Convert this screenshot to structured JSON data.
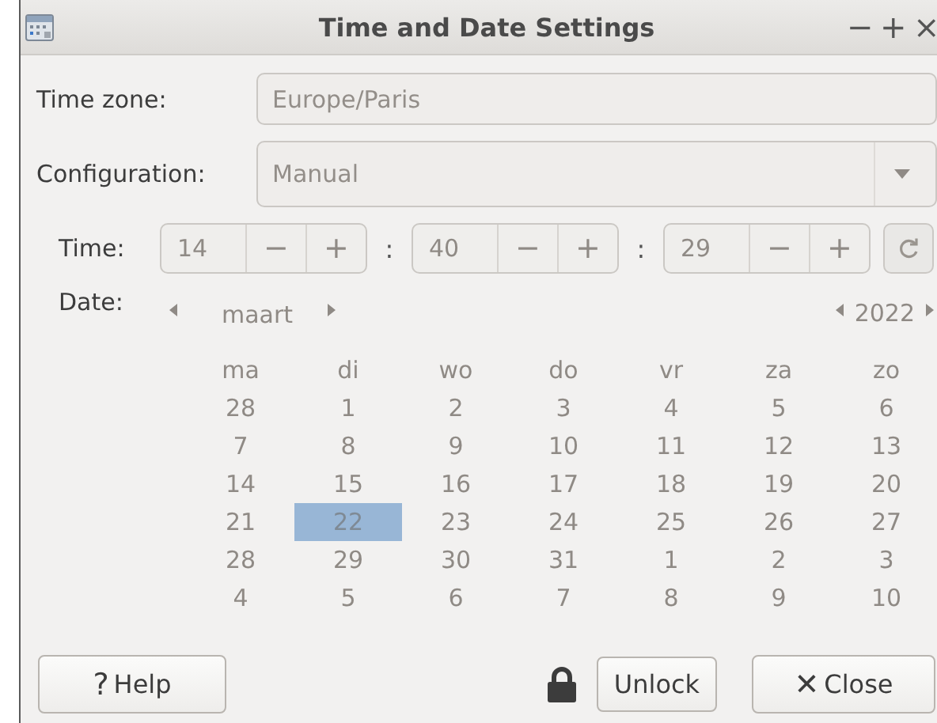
{
  "window": {
    "title": "Time and Date Settings",
    "controls": [
      "−",
      "+",
      "×"
    ]
  },
  "time_zone": {
    "label": "Time zone:",
    "value": "Europe/Paris"
  },
  "configuration": {
    "label": "Configuration:",
    "value": "Manual"
  },
  "time": {
    "label": "Time:",
    "fields": [
      {
        "value": "14",
        "decrement": "−",
        "increment": "+"
      },
      {
        "value": "40",
        "decrement": "−",
        "increment": "+"
      },
      {
        "value": "29",
        "decrement": "−",
        "increment": "+"
      }
    ],
    "separators": [
      ":",
      ":"
    ]
  },
  "date": {
    "label": "Date:",
    "month": "maart",
    "year": "2022",
    "weekdays": [
      "ma",
      "di",
      "wo",
      "do",
      "vr",
      "za",
      "zo"
    ],
    "weeks": [
      [
        {
          "day": "28",
          "selected": false
        },
        {
          "day": "1",
          "selected": false
        },
        {
          "day": "2",
          "selected": false
        },
        {
          "day": "3",
          "selected": false
        },
        {
          "day": "4",
          "selected": false
        },
        {
          "day": "5",
          "selected": false
        },
        {
          "day": "6",
          "selected": false
        }
      ],
      [
        {
          "day": "7",
          "selected": false
        },
        {
          "day": "8",
          "selected": false
        },
        {
          "day": "9",
          "selected": false
        },
        {
          "day": "10",
          "selected": false
        },
        {
          "day": "11",
          "selected": false
        },
        {
          "day": "12",
          "selected": false
        },
        {
          "day": "13",
          "selected": false
        }
      ],
      [
        {
          "day": "14",
          "selected": false
        },
        {
          "day": "15",
          "selected": false
        },
        {
          "day": "16",
          "selected": false
        },
        {
          "day": "17",
          "selected": false
        },
        {
          "day": "18",
          "selected": false
        },
        {
          "day": "19",
          "selected": false
        },
        {
          "day": "20",
          "selected": false
        }
      ],
      [
        {
          "day": "21",
          "selected": false
        },
        {
          "day": "22",
          "selected": true
        },
        {
          "day": "23",
          "selected": false
        },
        {
          "day": "24",
          "selected": false
        },
        {
          "day": "25",
          "selected": false
        },
        {
          "day": "26",
          "selected": false
        },
        {
          "day": "27",
          "selected": false
        }
      ],
      [
        {
          "day": "28",
          "selected": false
        },
        {
          "day": "29",
          "selected": false
        },
        {
          "day": "30",
          "selected": false
        },
        {
          "day": "31",
          "selected": false
        },
        {
          "day": "1",
          "selected": false
        },
        {
          "day": "2",
          "selected": false
        },
        {
          "day": "3",
          "selected": false
        }
      ],
      [
        {
          "day": "4",
          "selected": false
        },
        {
          "day": "5",
          "selected": false
        },
        {
          "day": "6",
          "selected": false
        },
        {
          "day": "7",
          "selected": false
        },
        {
          "day": "8",
          "selected": false
        },
        {
          "day": "9",
          "selected": false
        },
        {
          "day": "10",
          "selected": false
        }
      ]
    ]
  },
  "buttons": {
    "help": {
      "icon": "?",
      "label": "Help"
    },
    "unlock": {
      "label": "Unlock"
    },
    "close": {
      "icon": "✕",
      "label": "Close"
    }
  }
}
